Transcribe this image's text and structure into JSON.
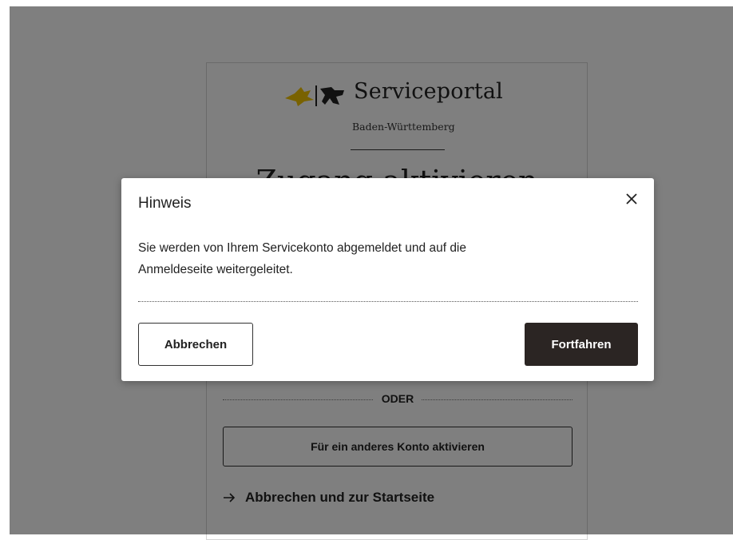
{
  "background_page": {
    "brand": {
      "title": "Serviceportal",
      "subtitle": "Baden-Württemberg"
    },
    "heading": "Zugang aktivieren",
    "divider_label": "ODER",
    "other_account_button": "Für ein anderes Konto aktivieren",
    "cancel_home_link": "Abbrechen und zur Startseite",
    "cancel_home_icon": "arrow-right-icon"
  },
  "modal": {
    "title": "Hinweis",
    "close_icon": "close-icon",
    "body_line1": "Sie werden von Ihrem Servicekonto abgemeldet und auf die",
    "body_line2": "Anmeldeseite weitergeleitet.",
    "cancel_button": "Abbrechen",
    "continue_button": "Fortfahren"
  },
  "colors": {
    "overlay": "rgba(0,0,0,0.5)",
    "primary_button": "#2b2523",
    "lion_yellow": "#f2c400"
  }
}
